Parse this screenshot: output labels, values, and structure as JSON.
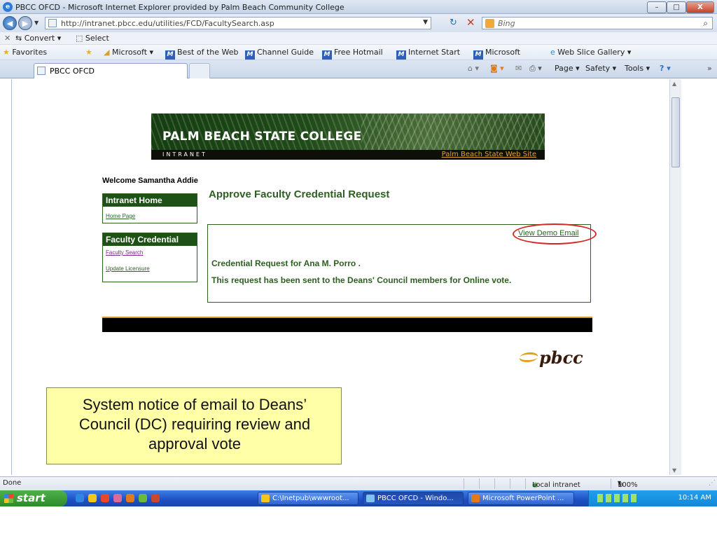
{
  "window": {
    "title": "PBCC OFCD - Microsoft Internet Explorer provided by Palm Beach Community College",
    "minimize": "–",
    "maximize": "□",
    "close": "X"
  },
  "address": {
    "url": "http://intranet.pbcc.edu/utilities/FCD/FacultySearch.asp",
    "search_placeholder": "Bing"
  },
  "toolbar": {
    "convert": "Convert",
    "select": "Select"
  },
  "favorites": {
    "label": "Favorites",
    "items": [
      "Microsoft",
      "Best of the Web",
      "Channel Guide",
      "Free Hotmail",
      "Internet Start",
      "Microsoft",
      "Web Slice Gallery"
    ]
  },
  "tab": {
    "label": "PBCC OFCD"
  },
  "commands": {
    "page": "Page",
    "safety": "Safety",
    "tools": "Tools"
  },
  "banner": {
    "college": "PALM BEACH STATE COLLEGE",
    "intranet": "INTRANET",
    "site_link": "Palm Beach State Web Site"
  },
  "page": {
    "welcome": "Welcome Samantha Addie",
    "title": "Approve Faculty Credential Request",
    "demo_email": "View Demo Email",
    "request_for": "Credential Request for Ana M. Porro .",
    "sent_message": "This request has been sent to the Deans' Council members for Online vote.",
    "logo": "pbcc"
  },
  "sidebar": {
    "intranet_home": {
      "title": "Intranet Home",
      "links": [
        "Home Page"
      ]
    },
    "faculty_credential": {
      "title": "Faculty Credential",
      "links": [
        "Faculty Search",
        "Update Licensure"
      ]
    }
  },
  "callout": {
    "lines": [
      "System notice of email to Deans’",
      "Council (DC) requiring review and",
      "approval vote"
    ]
  },
  "status": {
    "text": "Done",
    "zone": "Local intranet",
    "zoom": "100%"
  },
  "taskbar": {
    "start": "start",
    "tasks": [
      "C:\\Inetpub\\wwwroot...",
      "PBCC OFCD - Windo...",
      "Microsoft PowerPoint ..."
    ],
    "clock": "10:14 AM"
  },
  "colors": {
    "accent_green": "#1e5115",
    "link_green": "#2b6421",
    "highlight_red": "#d62626",
    "callout_yellow": "#ffffa8"
  }
}
